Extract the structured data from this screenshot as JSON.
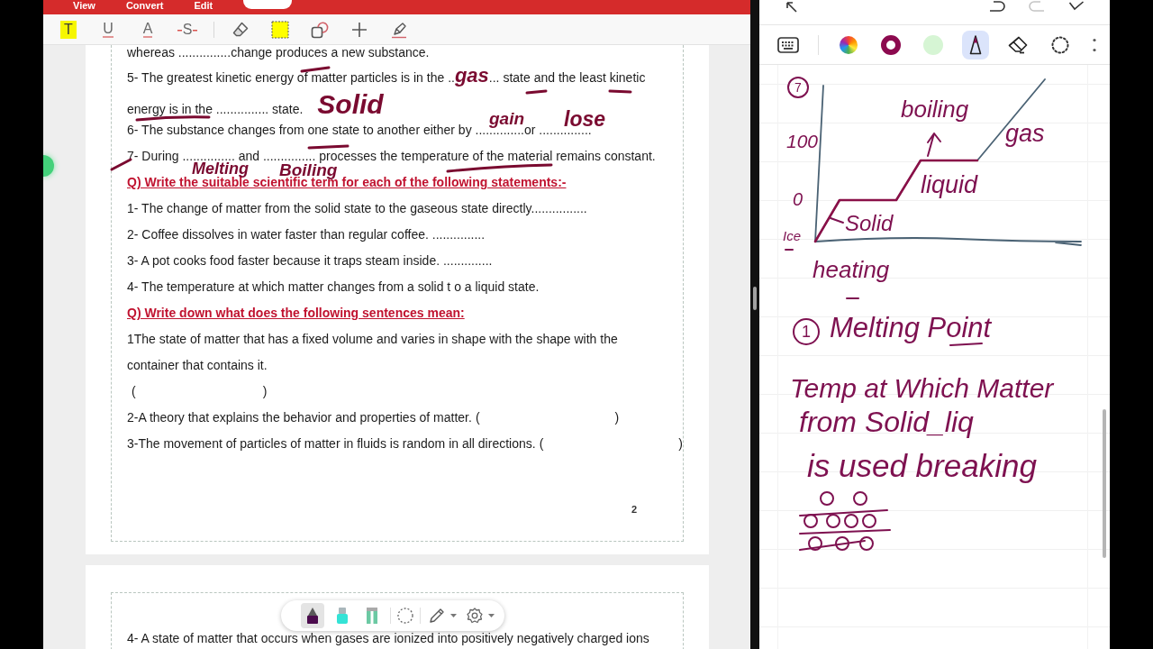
{
  "pdf_app": {
    "menu_tabs": [
      {
        "label": "View",
        "selected": false
      },
      {
        "label": "Convert",
        "selected": false
      },
      {
        "label": "Edit",
        "selected": false
      },
      {
        "selected": true
      }
    ],
    "text_tools": [
      {
        "kind": "highlight",
        "label": "T"
      },
      {
        "kind": "underline",
        "label": "U"
      },
      {
        "kind": "text-color",
        "label": "A"
      },
      {
        "kind": "strikeout",
        "label": "S"
      }
    ],
    "markup_tools": [
      {
        "kind": "eraser"
      },
      {
        "kind": "area-highlight"
      },
      {
        "kind": "shapes"
      },
      {
        "kind": "add"
      },
      {
        "kind": "signature"
      }
    ],
    "page_1": {
      "fill_in": [
        {
          "segments": [
            {
              "kind": "print",
              "text": "whereas ...............change produces a new substance."
            }
          ]
        },
        {
          "segments": [
            {
              "kind": "print",
              "text": "5- The greatest kinetic energy of matter particles is in the .."
            },
            {
              "kind": "ink",
              "text": "gas"
            },
            {
              "kind": "print",
              "text": "... state and the least kinetic"
            }
          ]
        },
        {
          "segments": [
            {
              "kind": "print",
              "text": "energy is in the ............... state."
            },
            {
              "kind": "ink",
              "text": "Solid"
            }
          ]
        },
        {
          "segments": [
            {
              "kind": "print",
              "text": "6- The substance changes from one state to another either by ..............or ..............."
            }
          ]
        },
        {
          "segments": [
            {
              "kind": "print",
              "text": "7- During ............... and ............... processes the temperature of the material remains constant."
            }
          ]
        }
      ],
      "sections": [
        {
          "heading": "Q) Write the suitable scientific term for each of the following statements:-",
          "items": [
            {
              "kind": "plain",
              "text": "1- The change of matter from the solid state to the gaseous state directly................"
            },
            {
              "kind": "plain",
              "text": "2- Coffee dissolves in water faster than regular coffee. ..............."
            },
            {
              "kind": "plain",
              "text": "3- A pot cooks food faster because it traps steam inside. .............."
            },
            {
              "kind": "plain",
              "text": "4- The temperature at which matter changes from a solid t o a liquid state."
            }
          ]
        },
        {
          "heading": "Q) Write down what does the following sentences mean:",
          "items": [
            {
              "kind": "blank-below",
              "text": "1The state of matter that has a fixed volume and varies in shape with the shape with the container that contains it.",
              "open": "(",
              "close": ")"
            },
            {
              "kind": "blank-inline",
              "text": "2-A theory that explains the behavior and properties of matter.",
              "open": "(",
              "close": ")"
            },
            {
              "kind": "blank-inline",
              "text": "3-The movement of particles of matter in fluids is random in all directions.",
              "open": "(",
              "close": ")"
            }
          ]
        }
      ],
      "page_number": "2",
      "handwriting": [
        {
          "text": "gain"
        },
        {
          "text": "lose"
        },
        {
          "text": "Melting"
        },
        {
          "text": "Boiling"
        }
      ]
    },
    "page_2": {
      "lines": [
        {
          "text": "4- A state of matter that occurs when gases are ionized into positively negatively charged ions"
        }
      ]
    },
    "pen_bar": {
      "pens": [
        {
          "kind": "marker",
          "color": "#4b0b4d",
          "selected": true
        },
        {
          "kind": "highlighter",
          "color": "#34e3d6",
          "selected": false
        },
        {
          "kind": "wide-highlighter",
          "color": "#6cc9a3",
          "selected": false
        }
      ],
      "tools": [
        {
          "kind": "lasso"
        },
        {
          "kind": "pen-options"
        },
        {
          "kind": "settings"
        }
      ]
    }
  },
  "notes_app": {
    "actions": [
      {
        "kind": "undo",
        "disabled": false
      },
      {
        "kind": "redo",
        "disabled": true
      },
      {
        "kind": "done",
        "disabled": false
      }
    ],
    "swatches": [
      {
        "color": "#8c0a4f",
        "selected": true
      },
      {
        "color": "#d6f5d4",
        "selected": false
      }
    ],
    "tools": [
      {
        "kind": "pen",
        "selected": true
      },
      {
        "kind": "eraser",
        "selected": false
      },
      {
        "kind": "lasso",
        "selected": false
      }
    ],
    "handwriting": [
      {
        "kind": "circled",
        "text": "7"
      },
      {
        "kind": "label",
        "text": "boiling"
      },
      {
        "kind": "label",
        "text": "100"
      },
      {
        "kind": "label",
        "text": "gas"
      },
      {
        "kind": "label",
        "text": "0"
      },
      {
        "kind": "label",
        "text": "liquid"
      },
      {
        "kind": "label",
        "text": "Solid"
      },
      {
        "kind": "label",
        "text": "Ice"
      },
      {
        "kind": "label",
        "text": "heating"
      },
      {
        "kind": "circled",
        "text": "1"
      },
      {
        "kind": "label",
        "text": "Melting Point"
      },
      {
        "kind": "label",
        "text": "Temp at Which Matter"
      },
      {
        "kind": "label",
        "text": "from Solid_liq"
      },
      {
        "kind": "label",
        "text": "is used breaking"
      }
    ]
  }
}
